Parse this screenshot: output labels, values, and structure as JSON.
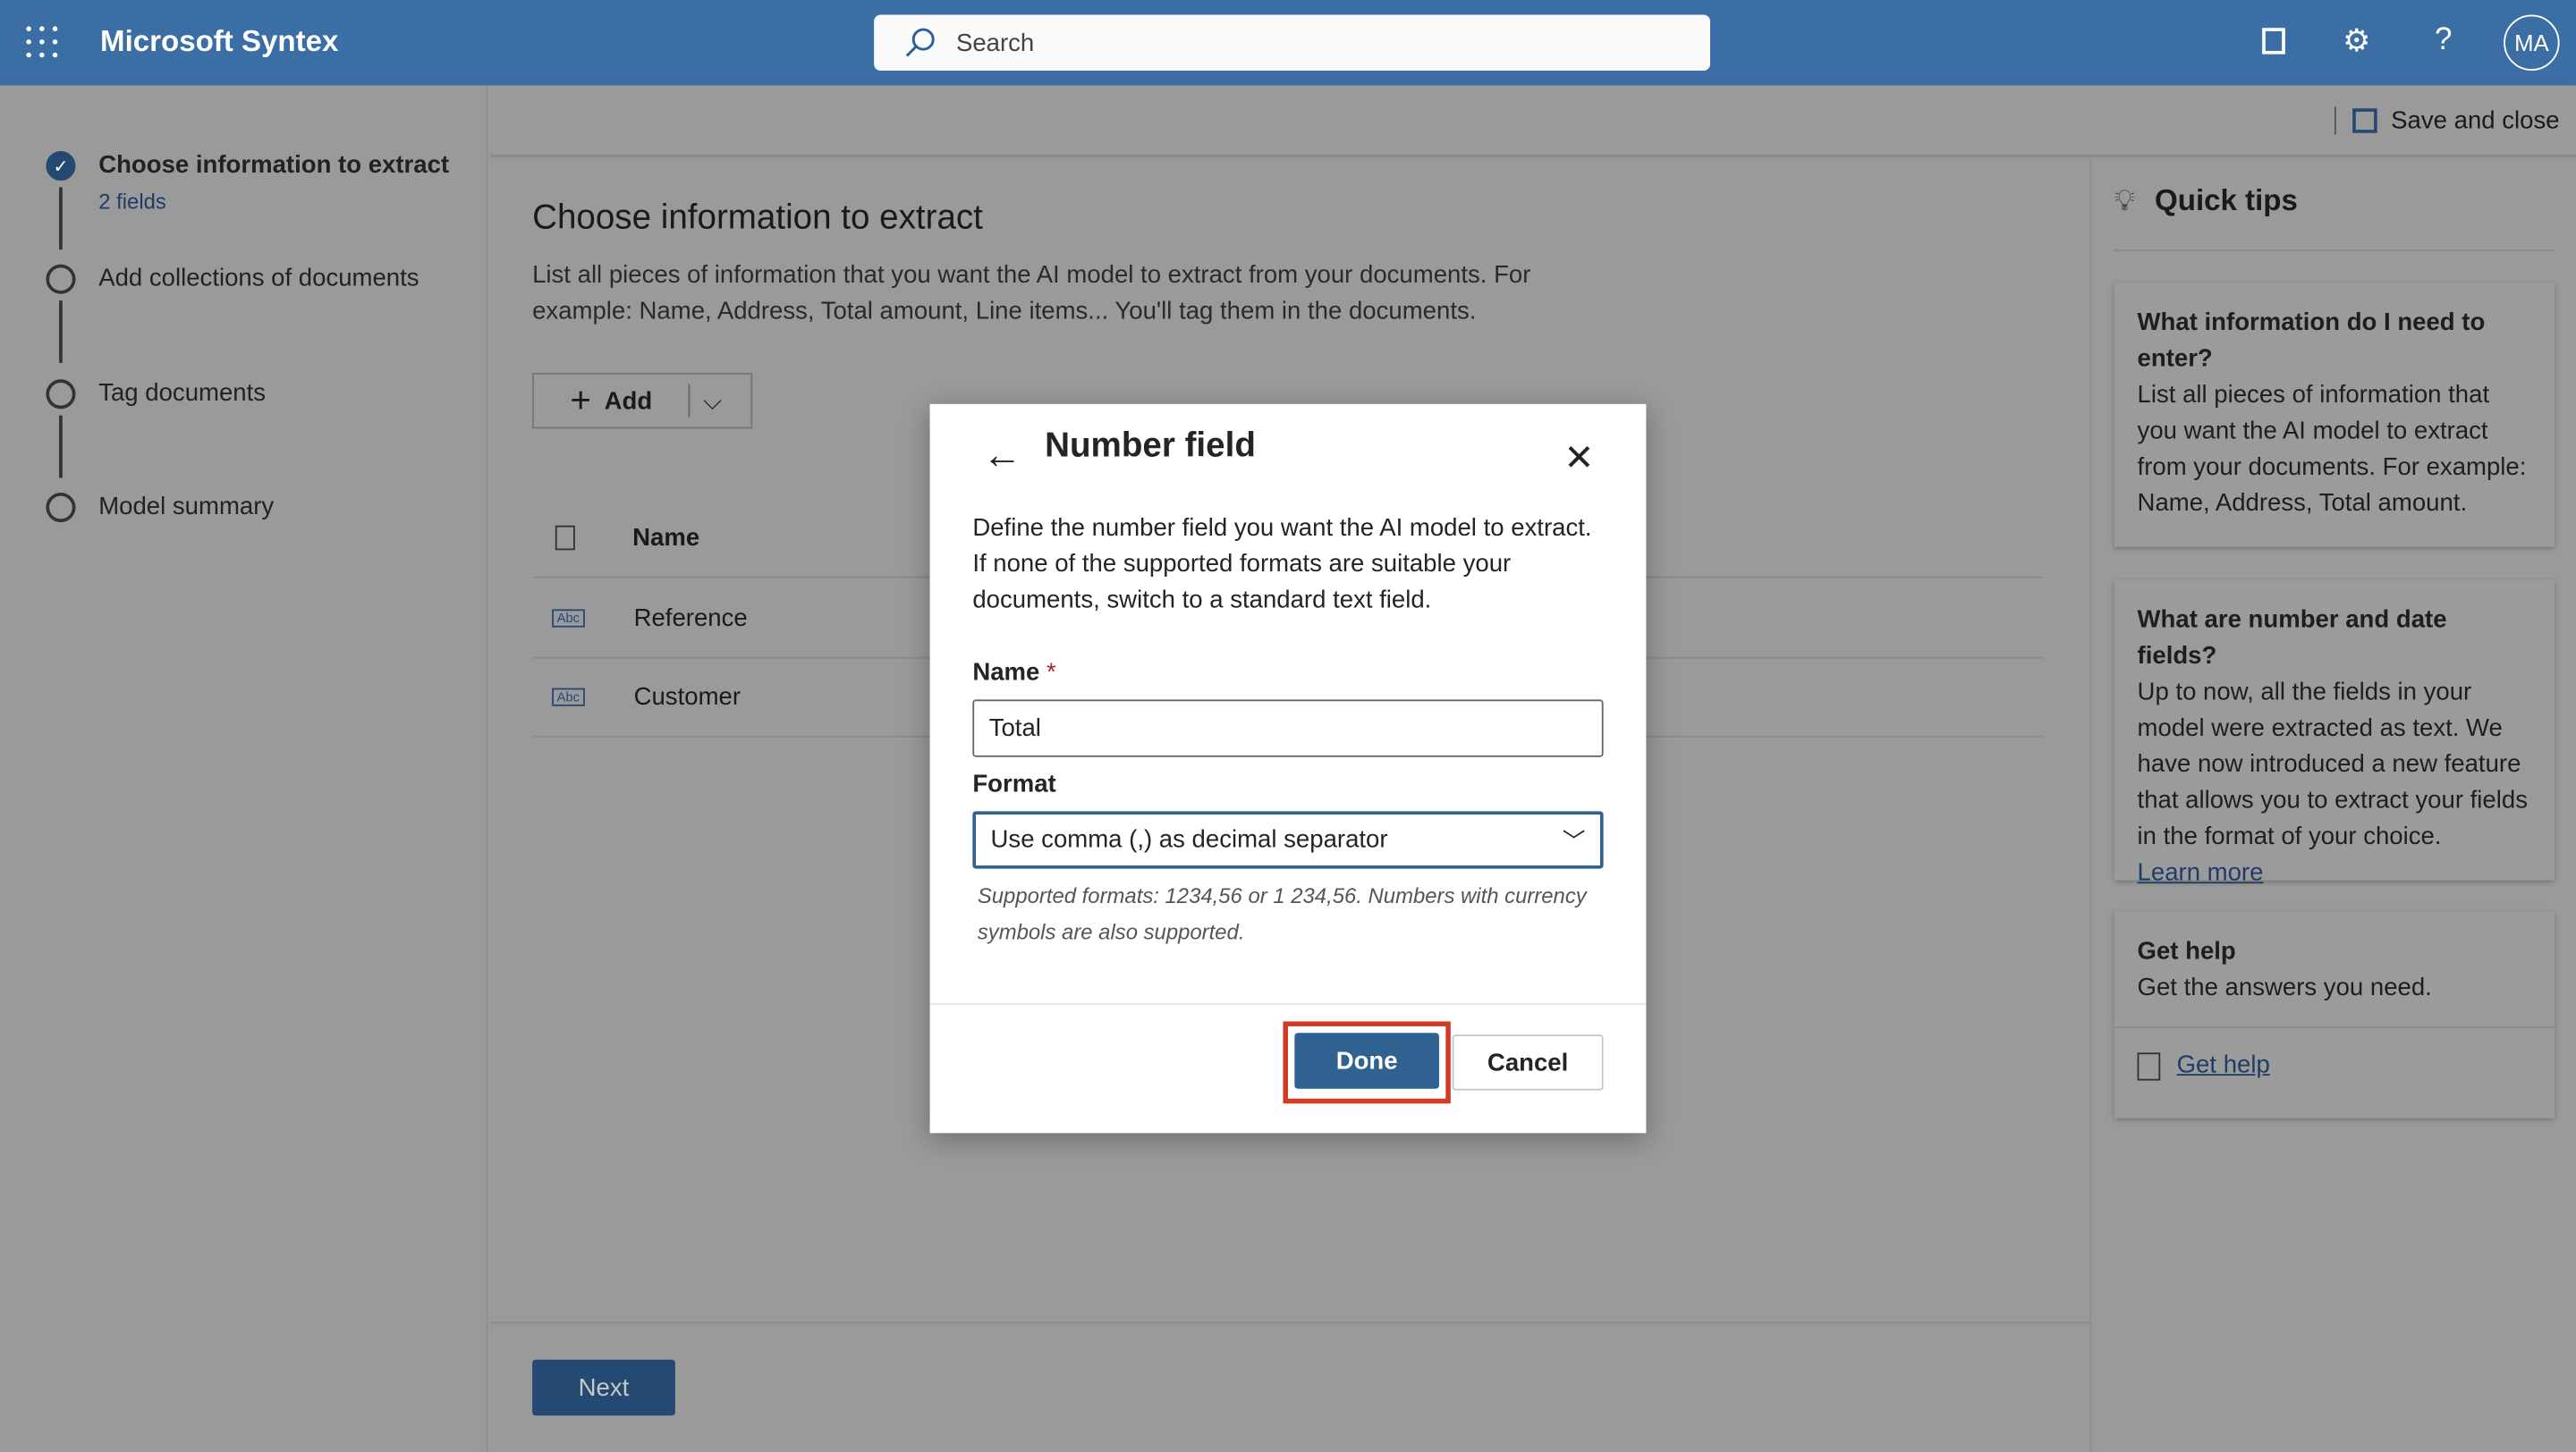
{
  "app": {
    "title": "Microsoft Syntex",
    "search_placeholder": "Search",
    "avatar_initials": "MA"
  },
  "steps": [
    {
      "label": "Choose information to extract",
      "sub": "2 fields",
      "status": "done"
    },
    {
      "label": "Add collections of documents",
      "status": "pending"
    },
    {
      "label": "Tag documents",
      "status": "pending"
    },
    {
      "label": "Model summary",
      "status": "pending"
    }
  ],
  "command_bar": {
    "save_close": "Save and close"
  },
  "main": {
    "title": "Choose information to extract",
    "description": "List all pieces of information that you want the AI model to extract from your documents. For example: Name, Address, Total amount, Line items... You'll tag them in the documents.",
    "add_label": "Add",
    "column_name": "Name",
    "rows": [
      {
        "name": "Reference",
        "type": "Abc"
      },
      {
        "name": "Customer",
        "type": "Abc"
      }
    ],
    "next_label": "Next"
  },
  "tips": {
    "title": "Quick tips",
    "cards": [
      {
        "heading": "What information do I need to enter?",
        "body": "List all pieces of information that you want the AI model to extract from your documents. For example: Name, Address, Total amount."
      },
      {
        "heading": "What are number and date fields?",
        "body": "Up to now, all the fields in your model were extracted as text. We have now introduced a new feature that allows you to extract your fields in the format of your choice.",
        "link": "Learn more"
      },
      {
        "heading": "Get help",
        "body": "Get the answers you need.",
        "link": "Get help"
      }
    ]
  },
  "dialog": {
    "title": "Number field",
    "description": "Define the number field you want the AI model to extract. If none of the supported formats are suitable your documents, switch to a standard text field.",
    "name_label": "Name",
    "required_mark": "*",
    "name_value": "Total",
    "format_label": "Format",
    "format_value": "Use comma (,) as decimal separator",
    "hint": "Supported formats: 1234,56 or 1 234,56. Numbers with currency symbols are also supported.",
    "done": "Done",
    "cancel": "Cancel",
    "highlight_color": "#d13b26",
    "primary_color": "#2f6291"
  }
}
